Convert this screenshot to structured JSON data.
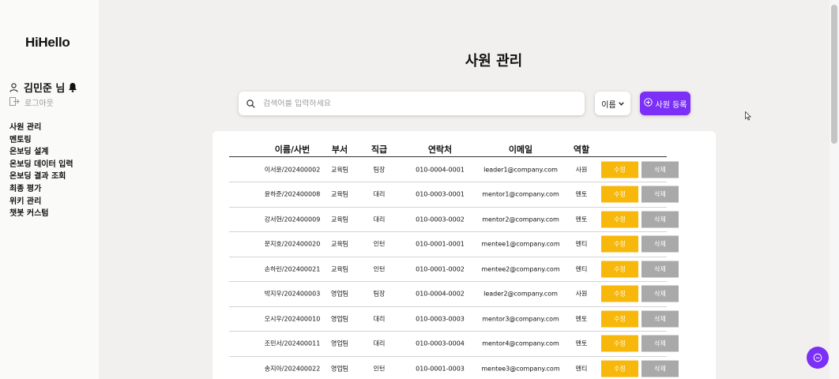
{
  "app": {
    "logo": "HiHello"
  },
  "user": {
    "name": "김민준 님",
    "logout_label": "로그아웃"
  },
  "sidebar": {
    "items": [
      {
        "label": "사원 관리"
      },
      {
        "label": "멘토링"
      },
      {
        "label": "온보딩 설계"
      },
      {
        "label": "온보딩 데이터 입력"
      },
      {
        "label": "온보딩 결과 조회"
      },
      {
        "label": "최종 평가"
      },
      {
        "label": "위키 관리"
      },
      {
        "label": "챗봇 커스텀"
      }
    ]
  },
  "main": {
    "title": "사원 관리",
    "search": {
      "placeholder": "검색어를 입력하세요",
      "value": ""
    },
    "filter": {
      "selected": "이름"
    },
    "add_button": "사원 등록",
    "accent_color": "#7b2ff7",
    "table": {
      "headers": [
        "이름/사번",
        "부서",
        "직급",
        "연락처",
        "이메일",
        "역할"
      ],
      "edit_label": "수정",
      "delete_label": "삭제",
      "rows": [
        {
          "name": "이서윤/202400002",
          "dept": "교육팀",
          "rank": "팀장",
          "phone": "010-0004-0001",
          "email": "leader1@company.com",
          "role": "사원"
        },
        {
          "name": "윤하준/202400008",
          "dept": "교육팀",
          "rank": "대리",
          "phone": "010-0003-0001",
          "email": "mentor1@company.com",
          "role": "멘토"
        },
        {
          "name": "강서현/202400009",
          "dept": "교육팀",
          "rank": "대리",
          "phone": "010-0003-0002",
          "email": "mentor2@company.com",
          "role": "멘토"
        },
        {
          "name": "문지호/202400020",
          "dept": "교육팀",
          "rank": "인턴",
          "phone": "010-0001-0001",
          "email": "mentee1@company.com",
          "role": "멘티"
        },
        {
          "name": "손하린/202400021",
          "dept": "교육팀",
          "rank": "인턴",
          "phone": "010-0001-0002",
          "email": "mentee2@company.com",
          "role": "멘티"
        },
        {
          "name": "박지우/202400003",
          "dept": "영업팀",
          "rank": "팀장",
          "phone": "010-0004-0002",
          "email": "leader2@company.com",
          "role": "사원"
        },
        {
          "name": "오시우/202400010",
          "dept": "영업팀",
          "rank": "대리",
          "phone": "010-0003-0003",
          "email": "mentor3@company.com",
          "role": "멘토"
        },
        {
          "name": "조민서/202400011",
          "dept": "영업팀",
          "rank": "대리",
          "phone": "010-0003-0004",
          "email": "mentor4@company.com",
          "role": "멘토"
        },
        {
          "name": "송지아/202400022",
          "dept": "영업팀",
          "rank": "인턴",
          "phone": "010-0001-0003",
          "email": "mentee3@company.com",
          "role": "멘티"
        }
      ]
    }
  },
  "icons": {
    "user": "user-icon",
    "bell": "bell-icon",
    "logout": "logout-icon",
    "search": "search-icon",
    "chevron": "chevron-down-icon",
    "add": "plus-circle-icon",
    "chat": "chat-icon"
  }
}
